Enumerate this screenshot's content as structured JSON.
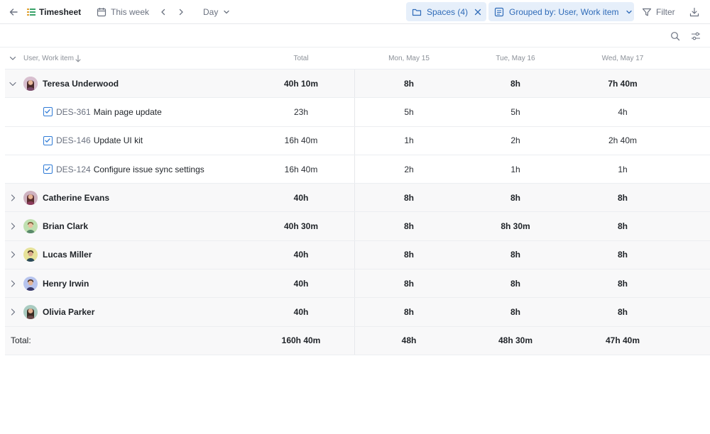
{
  "topbar": {
    "back_icon": "arrow-left-icon",
    "app_icon": "list-icon",
    "title": "Timesheet",
    "calendar_icon": "calendar-icon",
    "period": "This week",
    "view": "Day",
    "spaces_label": "Spaces (4)",
    "group_label": "Grouped by: User, Work item",
    "filter_label": "Filter",
    "accent": "#2f6bb8",
    "pill_bg": "#e6effa"
  },
  "table": {
    "headers": {
      "name": "User, Work item",
      "total": "Total",
      "d1": "Mon, May 15",
      "d2": "Tue, May 16",
      "d3": "Wed, May 17"
    },
    "rows": [
      {
        "name": "Teresa Underwood",
        "total": "40h 10m",
        "d1": "8h",
        "d2": "8h",
        "d3": "7h 40m"
      },
      {
        "key": "DES-361",
        "title": "Main page update",
        "total": "23h",
        "d1": "5h",
        "d2": "5h",
        "d3": "4h"
      },
      {
        "key": "DES-146",
        "title": "Update UI kit",
        "total": "16h 40m",
        "d1": "1h",
        "d2": "2h",
        "d3": "2h 40m"
      },
      {
        "key": "DES-124",
        "title": "Configure issue sync settings",
        "total": "16h 40m",
        "d1": "2h",
        "d2": "1h",
        "d3": "1h"
      },
      {
        "name": "Catherine Evans",
        "total": "40h",
        "d1": "8h",
        "d2": "8h",
        "d3": "8h"
      },
      {
        "name": "Brian Clark",
        "total": "40h 30m",
        "d1": "8h",
        "d2": "8h 30m",
        "d3": "8h"
      },
      {
        "name": "Lucas Miller",
        "total": "40h",
        "d1": "8h",
        "d2": "8h",
        "d3": "8h"
      },
      {
        "name": "Henry Irwin",
        "total": "40h",
        "d1": "8h",
        "d2": "8h",
        "d3": "8h"
      },
      {
        "name": "Olivia Parker",
        "total": "40h",
        "d1": "8h",
        "d2": "8h",
        "d3": "8h"
      }
    ],
    "footer": {
      "label": "Total:",
      "total": "160h 40m",
      "d1": "48h",
      "d2": "48h 30m",
      "d3": "47h 40m"
    }
  }
}
